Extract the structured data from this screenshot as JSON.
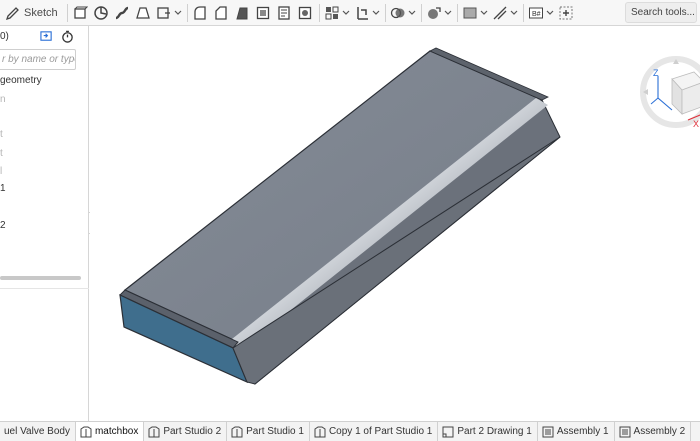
{
  "toolbar": {
    "sketch_label": "Sketch",
    "search_label": "Search tools...",
    "tools": [
      "extrude-icon",
      "revolve-icon",
      "sweep-icon",
      "loft-icon",
      "thicken-icon",
      "fillet-icon",
      "chamfer-icon",
      "draft-icon",
      "shell-icon",
      "hole-icon",
      "pattern-icon",
      "boolean-icon",
      "transform-icon",
      "mate-connector-icon",
      "plane-icon",
      "variable-icon",
      "point-icon"
    ]
  },
  "feature_panel": {
    "count": "0)",
    "search_placeholder": "r by name or type",
    "items": [
      {
        "label": "geometry",
        "style": "dark"
      },
      {
        "label": "n",
        "style": "dim"
      },
      {
        "label": "t",
        "style": "dim"
      },
      {
        "label": "t",
        "style": "dim"
      },
      {
        "label": "l",
        "style": "dim"
      },
      {
        "label": "1",
        "style": "dark"
      },
      {
        "label": "2",
        "style": "dark"
      }
    ]
  },
  "viewcube": {
    "axis_z": "Z",
    "axis_x": "X"
  },
  "tabs": [
    {
      "label": "uel Valve Body",
      "icon": "part-studio-icon",
      "active": false
    },
    {
      "label": "matchbox",
      "icon": "part-studio-icon",
      "active": true
    },
    {
      "label": "Part Studio 2",
      "icon": "part-studio-icon",
      "active": false
    },
    {
      "label": "Part Studio 1",
      "icon": "part-studio-icon",
      "active": false
    },
    {
      "label": "Copy 1 of Part Studio 1",
      "icon": "part-studio-icon",
      "active": false
    },
    {
      "label": "Part 2 Drawing 1",
      "icon": "drawing-icon",
      "active": false
    },
    {
      "label": "Assembly 1",
      "icon": "assembly-icon",
      "active": false
    },
    {
      "label": "Assembly 2",
      "icon": "assembly-icon",
      "active": false
    }
  ],
  "colors": {
    "part_top": "#7d848f",
    "part_front": "#3f6e8d",
    "part_side": "#6b717b",
    "edge": "#2b2f36",
    "viewcube_x": "#e0303a",
    "viewcube_z": "#2a6fd6"
  }
}
